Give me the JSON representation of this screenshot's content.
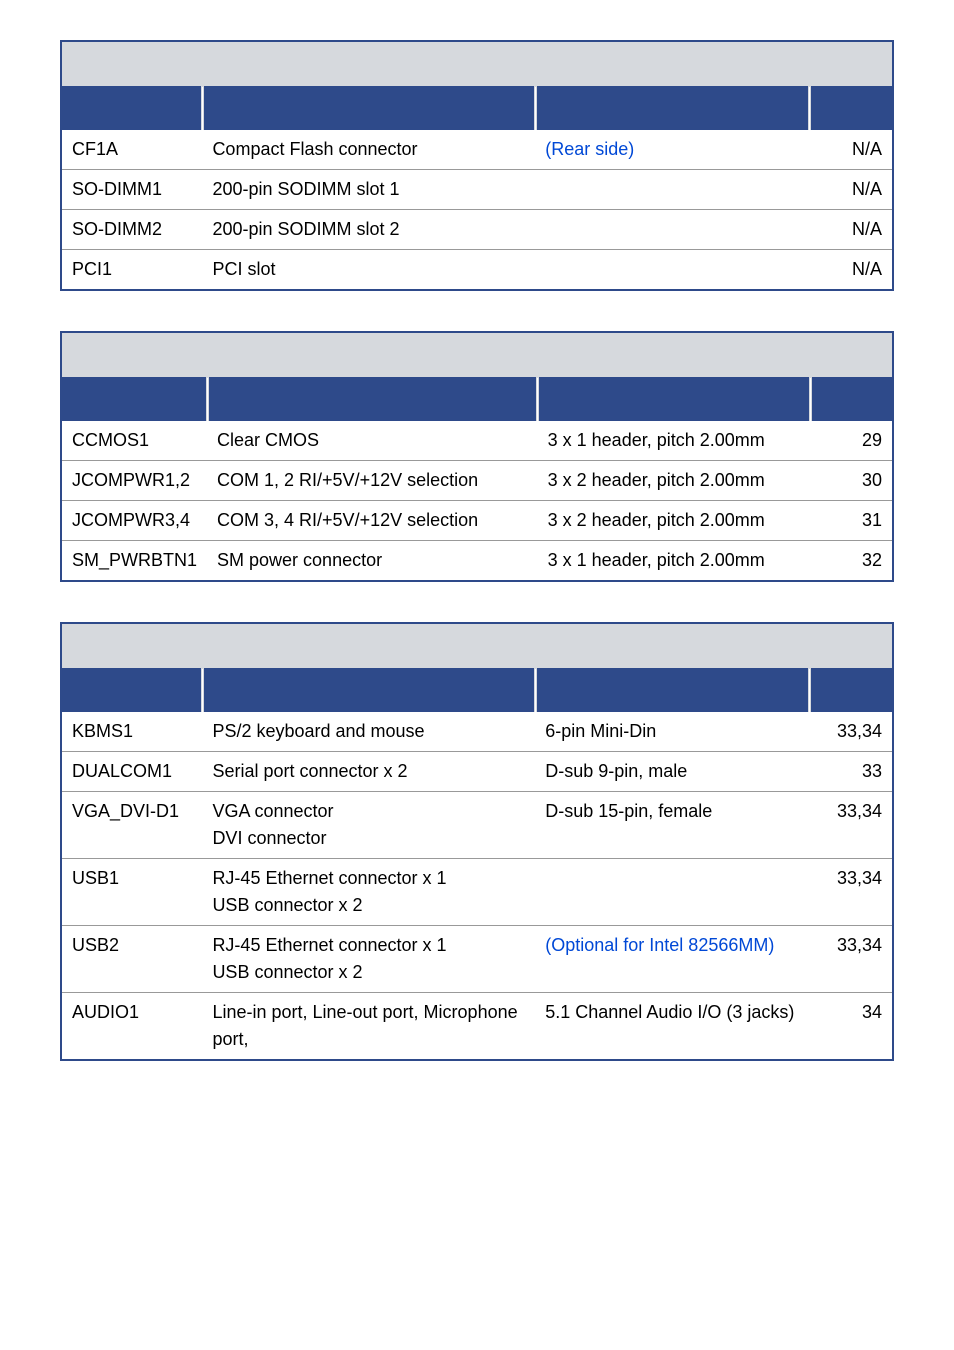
{
  "tables": [
    {
      "rows": [
        {
          "label": "CF1A",
          "func": "Compact Flash connector",
          "type": "(Rear side)",
          "typeBlue": true,
          "page": "N/A"
        },
        {
          "label": "SO-DIMM1",
          "func": "200-pin SODIMM slot 1",
          "type": "",
          "page": "N/A"
        },
        {
          "label": "SO-DIMM2",
          "func": "200-pin SODIMM slot 2",
          "type": "",
          "page": "N/A"
        },
        {
          "label": "PCI1",
          "func": "PCI slot",
          "type": "",
          "page": "N/A"
        }
      ]
    },
    {
      "rows": [
        {
          "label": "CCMOS1",
          "func": "Clear CMOS",
          "type": "3 x 1 header, pitch 2.00mm",
          "page": "29"
        },
        {
          "label": "JCOMPWR1,2",
          "func": "COM 1, 2 RI/+5V/+12V selection",
          "type": "3 x 2 header, pitch 2.00mm",
          "page": "30"
        },
        {
          "label": "JCOMPWR3,4",
          "func": "COM 3, 4 RI/+5V/+12V selection",
          "type": "3 x 2 header, pitch 2.00mm",
          "page": "31"
        },
        {
          "label": "SM_PWRBTN1",
          "func": "SM power connector",
          "type": "3 x 1 header, pitch 2.00mm",
          "page": "32"
        }
      ]
    },
    {
      "rows": [
        {
          "label": "KBMS1",
          "func": "PS/2 keyboard and mouse",
          "type": "6-pin Mini-Din",
          "page": "33,34"
        },
        {
          "label": "DUALCOM1",
          "func": "Serial port connector x 2",
          "type": "D-sub 9-pin, male",
          "page": "33"
        },
        {
          "label": "VGA_DVI-D1",
          "func": "VGA connector\nDVI connector",
          "type": "D-sub 15-pin, female",
          "page": "33,34"
        },
        {
          "label": "USB1",
          "func": "RJ-45 Ethernet connector x 1\nUSB connector x 2",
          "type": "",
          "page": "33,34"
        },
        {
          "label": "USB2",
          "func": "RJ-45 Ethernet connector x 1\nUSB connector x 2",
          "type": "(Optional for Intel 82566MM)",
          "typeBlue": true,
          "page": "33,34"
        },
        {
          "label": "AUDIO1",
          "func": "Line-in port, Line-out port, Microphone port,",
          "type": "5.1 Channel Audio I/O (3 jacks)",
          "page": "34"
        }
      ]
    }
  ]
}
